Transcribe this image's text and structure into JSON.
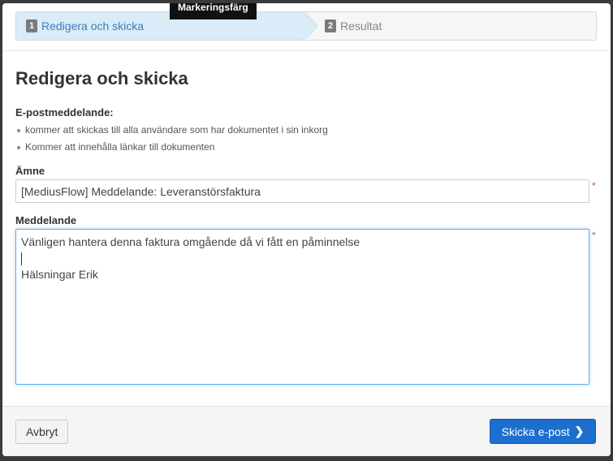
{
  "tooltip": "Markeringsfärg",
  "steps": [
    {
      "num": "1",
      "label": "Redigera och skicka"
    },
    {
      "num": "2",
      "label": "Resultat"
    }
  ],
  "title": "Redigera och skicka",
  "info": {
    "label": "E-postmeddelande:",
    "bullets": [
      "kommer att skickas till alla användare som har dokumentet i sin inkorg",
      "Kommer att innehålla länkar till dokumenten"
    ]
  },
  "subject": {
    "label": "Ämne",
    "value": "[MediusFlow] Meddelande: Leveranstörsfaktura",
    "required": "*"
  },
  "message": {
    "label": "Meddelande",
    "required": "*",
    "lines": [
      "Vänligen hantera denna faktura omgående då vi fått en påminnelse",
      "",
      "Hälsningar Erik"
    ]
  },
  "footer": {
    "cancel": "Avbryt",
    "send": "Skicka e-post",
    "send_icon": "chevron-right-icon"
  }
}
